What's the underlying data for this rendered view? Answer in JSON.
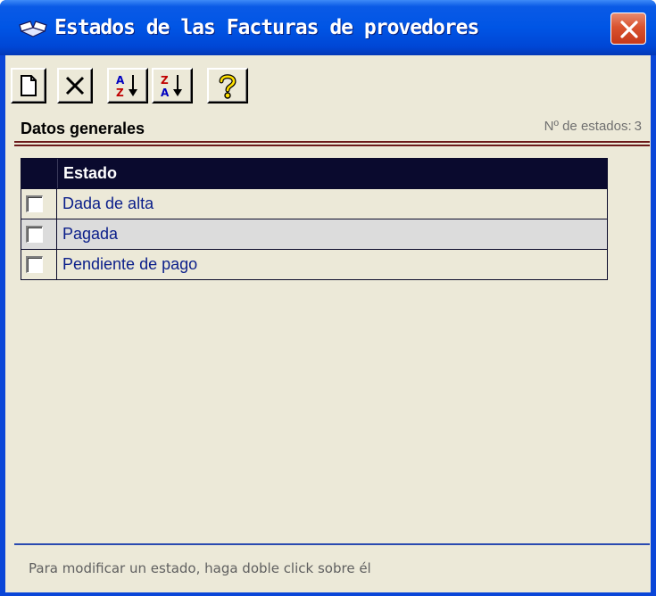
{
  "window": {
    "title": "Estados de las Facturas de provedores",
    "title_icon": "open-book-icon",
    "close_icon": "close-icon"
  },
  "toolbar": {
    "buttons": [
      {
        "name": "new-button",
        "icon": "new-document-icon"
      },
      {
        "name": "delete-button",
        "icon": "delete-x-icon"
      },
      {
        "name": "sort-ascending-button",
        "icon": "sort-az-icon"
      },
      {
        "name": "sort-descending-button",
        "icon": "sort-za-icon"
      },
      {
        "name": "help-button",
        "icon": "help-question-icon"
      }
    ]
  },
  "section": {
    "title": "Datos generales",
    "count_label": "Nº de estados:",
    "count_value": "3"
  },
  "table": {
    "header": "Estado",
    "rows": [
      {
        "estado": "Dada de alta",
        "checked": false
      },
      {
        "estado": "Pagada",
        "checked": false
      },
      {
        "estado": "Pendiente de pago",
        "checked": false
      }
    ]
  },
  "status": {
    "hint": "Para modificar un estado, haga doble click sobre él"
  },
  "colors": {
    "titlebar": "#0055e5",
    "client_bg": "#ece9d8",
    "grid_header": "#0a0a2e",
    "row_text": "#0a1e8a",
    "rule": "#6b1a1a",
    "close_button": "#d9532f"
  }
}
